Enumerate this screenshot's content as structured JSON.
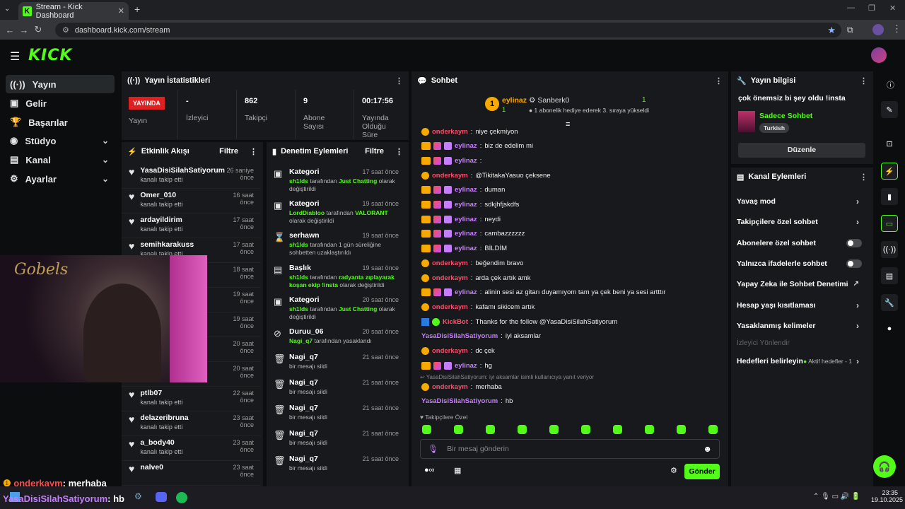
{
  "browser": {
    "tab_title": "Stream - Kick Dashboard",
    "url": "dashboard.kick.com/stream"
  },
  "brand": {
    "logo": "KICK",
    "accent": "#53fc18"
  },
  "sidebar": {
    "items": [
      {
        "label": "Yayın",
        "icon": "broadcast-icon"
      },
      {
        "label": "Gelir",
        "icon": "money-icon"
      },
      {
        "label": "Başarılar",
        "icon": "trophy-icon"
      },
      {
        "label": "Stüdyo",
        "icon": "studio-icon"
      },
      {
        "label": "Kanal",
        "icon": "channel-icon"
      },
      {
        "label": "Ayarlar",
        "icon": "settings-icon"
      }
    ]
  },
  "stats": {
    "title": "Yayın İstatistikleri",
    "live_badge": "YAYINDA",
    "live_label": "Yayın",
    "viewers_value": "-",
    "viewers_label": "İzleyici",
    "followers_value": "862",
    "followers_label": "Takipçi",
    "subs_value": "9",
    "subs_label": "Abone Sayısı",
    "duration_value": "00:17:56",
    "duration_label": "Yayında Olduğu Süre"
  },
  "events": {
    "title": "Etkinlik Akışı",
    "filter": "Filtre",
    "items": [
      {
        "name": "YasaDisiSilahSatiyorum",
        "sub": "kanalı takip etti",
        "time": "26 saniye önce"
      },
      {
        "name": "Omer_010",
        "sub": "kanalı takip etti",
        "time": "16 saat önce"
      },
      {
        "name": "ardayildirim",
        "sub": "kanalı takip etti",
        "time": "17 saat önce"
      },
      {
        "name": "semihkarakuss",
        "sub": "kanalı takip etti",
        "time": "17 saat önce"
      },
      {
        "name": "",
        "sub": "kanalı takip etti",
        "time": "18 saat önce"
      },
      {
        "name": "",
        "sub": "kanalı takip etti",
        "time": "19 saat önce"
      },
      {
        "name": "",
        "sub": "kanalı takip etti",
        "time": "19 saat önce"
      },
      {
        "name": "",
        "sub": "kanalı takip etti",
        "time": "20 saat önce"
      },
      {
        "name": "",
        "sub": "kanalı takip etti",
        "time": "20 saat önce"
      },
      {
        "name": "ptlb07",
        "sub": "kanalı takip etti",
        "time": "22 saat önce"
      },
      {
        "name": "delazeribruna",
        "sub": "kanalı takip etti",
        "time": "23 saat önce"
      },
      {
        "name": "a_body40",
        "sub": "kanalı takip etti",
        "time": "23 saat önce"
      },
      {
        "name": "nalve0",
        "sub": "",
        "time": "23 saat önce"
      }
    ]
  },
  "moderation": {
    "title": "Denetim Eylemleri",
    "filter": "Filtre",
    "items": [
      {
        "name": "Kategori",
        "time": "17 saat önce",
        "actor": "sh1lds",
        "text": "tarafından",
        "target": "Just Chatting",
        "rest": "olarak değiştirildi",
        "icon": "category-icon"
      },
      {
        "name": "Kategori",
        "time": "19 saat önce",
        "actor": "LordDiabloo",
        "text": "tarafından",
        "target": "VALORANT",
        "rest": "olarak değiştirildi",
        "icon": "category-icon"
      },
      {
        "name": "serhawn",
        "time": "19 saat önce",
        "actor": "sh1lds",
        "text": "tarafından 1 gün süreliğine sohbetten uzaklaştırıldı",
        "target": "",
        "rest": "",
        "icon": "hourglass-icon"
      },
      {
        "name": "Başlık",
        "time": "19 saat önce",
        "actor": "sh1lds",
        "text": "tarafından",
        "target": "radyanta zıplayarak koşan ekip !insta",
        "rest": "olarak değiştirildi",
        "icon": "title-icon"
      },
      {
        "name": "Kategori",
        "time": "20 saat önce",
        "actor": "sh1lds",
        "text": "tarafından",
        "target": "Just Chatting",
        "rest": "olarak değiştirildi",
        "icon": "category-icon"
      },
      {
        "name": "Duruu_06",
        "time": "20 saat önce",
        "actor": "Nagi_q7",
        "text": "tarafından yasaklandı",
        "target": "",
        "rest": "",
        "icon": "ban-icon"
      },
      {
        "name": "Nagi_q7",
        "time": "21 saat önce",
        "actor": "",
        "text": "bir mesajı sildi",
        "target": "",
        "rest": "",
        "icon": "trash-icon"
      },
      {
        "name": "Nagi_q7",
        "time": "21 saat önce",
        "actor": "",
        "text": "bir mesajı sildi",
        "target": "",
        "rest": "",
        "icon": "trash-icon"
      },
      {
        "name": "Nagi_q7",
        "time": "21 saat önce",
        "actor": "",
        "text": "bir mesajı sildi",
        "target": "",
        "rest": "",
        "icon": "trash-icon"
      },
      {
        "name": "Nagi_q7",
        "time": "21 saat önce",
        "actor": "",
        "text": "bir mesajı sildi",
        "target": "",
        "rest": "",
        "icon": "trash-icon"
      },
      {
        "name": "Nagi_q7",
        "time": "21 saat önce",
        "actor": "",
        "text": "bir mesajı sildi",
        "target": "",
        "rest": "",
        "icon": "trash-icon"
      }
    ]
  },
  "chat": {
    "title": "Sohbet",
    "pinned": {
      "rank1_name": "eylinaz",
      "rank1_count": "1",
      "rank2_name": "Sanberk0",
      "rank2_text": "1 abonelik hediye ederek 3. sıraya yükseldi",
      "rank2_count": "1"
    },
    "messages": [
      {
        "badge": "one",
        "user": "onderkaym",
        "color": "#ff4d6a",
        "text": "niye çekmiyon"
      },
      {
        "badge": "crown",
        "user": "eylinaz",
        "color": "#c77dff",
        "text": "biz de edelim mi"
      },
      {
        "badge": "crown",
        "user": "eylinaz",
        "color": "#c77dff",
        "text": ""
      },
      {
        "badge": "one",
        "user": "onderkaym",
        "color": "#ff4d6a",
        "text": "@TikitakaYasuo çeksene"
      },
      {
        "badge": "crown",
        "user": "eylinaz",
        "color": "#c77dff",
        "text": "duman"
      },
      {
        "badge": "crown",
        "user": "eylinaz",
        "color": "#c77dff",
        "text": "sdkjhfjskdfs"
      },
      {
        "badge": "crown",
        "user": "eylinaz",
        "color": "#c77dff",
        "text": "neydi"
      },
      {
        "badge": "crown",
        "user": "eylinaz",
        "color": "#c77dff",
        "text": "cambazzzzzz"
      },
      {
        "badge": "crown",
        "user": "eylinaz",
        "color": "#c77dff",
        "text": "BİLDİM"
      },
      {
        "badge": "one",
        "user": "onderkaym",
        "color": "#ff4d6a",
        "text": "beğendim bravo"
      },
      {
        "badge": "one",
        "user": "onderkaym",
        "color": "#ff4d6a",
        "text": "arda çek artık amk"
      },
      {
        "badge": "crown",
        "user": "eylinaz",
        "color": "#c77dff",
        "text": "alinin sesi az gitarı duyamıyom tam ya çek beni ya sesi artttır"
      },
      {
        "badge": "one",
        "user": "onderkaym",
        "color": "#ff4d6a",
        "text": "kafamı sikicem artık"
      },
      {
        "badge": "bot",
        "user": "KickBot",
        "color": "#ff4d6a",
        "text": "Thanks for the follow @YasaDisiSilahSatiyorum"
      },
      {
        "badge": "none",
        "user": "YasaDisiSilahSatiyorum",
        "color": "#c77dff",
        "text": "iyi aksamlar"
      },
      {
        "badge": "one",
        "user": "onderkaym",
        "color": "#ff4d6a",
        "text": "dc çek"
      },
      {
        "badge": "crown",
        "user": "eylinaz",
        "color": "#c77dff",
        "text": "hg"
      }
    ],
    "reply_hint": "YasaDisiSilahSatiyorum: iyi aksamlar isimli kullanıcıya yanıt veriyor",
    "tail": [
      {
        "badge": "one",
        "user": "onderkaym",
        "color": "#ff4d6a",
        "text": "merhaba"
      },
      {
        "badge": "none",
        "user": "YasaDisiSilahSatiyorum",
        "color": "#c77dff",
        "text": "hb"
      }
    ],
    "emote_section": "Takipçilere Özel",
    "input_placeholder": "Bir mesaj gönderin",
    "send_label": "Gönder"
  },
  "stream_info": {
    "title": "Yayın bilgisi",
    "stream_title": "çok önemsiz bi şey oldu !insta",
    "category": "Sadece Sohbet",
    "language": "Turkish",
    "edit_label": "Düzenle"
  },
  "channel_actions": {
    "title": "Kanal Eylemleri",
    "items": [
      "Yavaş mod",
      "Takipçilere özel sohbet",
      "Abonelere özel sohbet",
      "Yalnızca ifadelerle sohbet",
      "Yapay Zeka ile Sohbet Denetimi",
      "Hesap yaşı kısıtlaması",
      "Yasaklanmış kelimeler",
      "İzleyici Yönlendir",
      "Hedefleri belirleyin"
    ],
    "goals_status": "Aktif hedefler - 1"
  },
  "overlay": {
    "line1_user": "onderkaym",
    "line1_text": ": merhaba",
    "line2_user": "YasaDisiSilahSatiyorum",
    "line2_text": ": hb"
  },
  "taskbar": {
    "time": "23:35",
    "date": "19.10.2025"
  }
}
